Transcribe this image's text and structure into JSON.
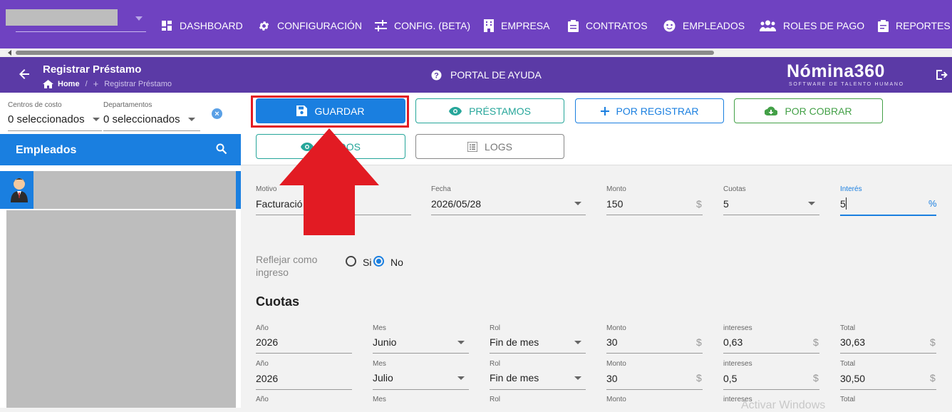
{
  "topnav": {
    "items": [
      {
        "label": "DASHBOARD",
        "icon": "dashboard-icon"
      },
      {
        "label": "CONFIGURACIÓN",
        "icon": "gear-icon"
      },
      {
        "label": "CONFIG. (BETA)",
        "icon": "sliders-icon"
      },
      {
        "label": "EMPRESA",
        "icon": "building-icon"
      },
      {
        "label": "CONTRATOS",
        "icon": "clipboard-icon"
      },
      {
        "label": "EMPLEADOS",
        "icon": "face-icon"
      },
      {
        "label": "ROLES DE PAGO",
        "icon": "group-icon"
      },
      {
        "label": "REPORTES",
        "icon": "report-icon"
      }
    ]
  },
  "header": {
    "title": "Registrar Préstamo",
    "breadcrumb_home": "Home",
    "breadcrumb_current": "Registrar Préstamo",
    "portal": "PORTAL DE AYUDA",
    "logo": "Nómina360",
    "logo_sub": "SOFTWARE DE TALENTO HUMANO"
  },
  "sidebar": {
    "centros_label": "Centros de costo",
    "centros_value": "0 seleccionados",
    "departamentos_label": "Departamentos",
    "departamentos_value": "0 seleccionados",
    "clear": "×",
    "empleados_title": "Empleados"
  },
  "toolbar": {
    "guardar": "GUARDAR",
    "prestamos": "PRÉSTAMOS",
    "por_registrar": "POR REGISTRAR",
    "por_cobrar": "POR COBRAR",
    "cobrados_visible": "B  ADOS",
    "logs": "LOGS"
  },
  "form": {
    "motivo_label": "Motivo",
    "motivo_value": "Facturació",
    "fecha_label": "Fecha",
    "fecha_value": "2026/05/28",
    "monto_label": "Monto",
    "monto_value": "150",
    "monto_suffix": "$",
    "cuotas_label": "Cuotas",
    "cuotas_value": "5",
    "interes_label": "Interés",
    "interes_value": "5",
    "interes_suffix": "%",
    "reflejar_label_1": "Reflejar como",
    "reflejar_label_2": "ingreso",
    "si": "Si",
    "no": "No",
    "reflejar_selected": "No"
  },
  "cuotas": {
    "title": "Cuotas",
    "headers": [
      "Año",
      "Mes",
      "Rol",
      "Monto",
      "intereses",
      "Total"
    ],
    "rows": [
      {
        "anio": "2026",
        "mes": "Junio",
        "rol": "Fin de mes",
        "monto": "30",
        "intereses": "0,63",
        "total": "30,63"
      },
      {
        "anio": "2026",
        "mes": "Julio",
        "rol": "Fin de mes",
        "monto": "30",
        "intereses": "0,5",
        "total": "30,50"
      }
    ],
    "currency": "$"
  },
  "watermark": "Activar Windows"
}
